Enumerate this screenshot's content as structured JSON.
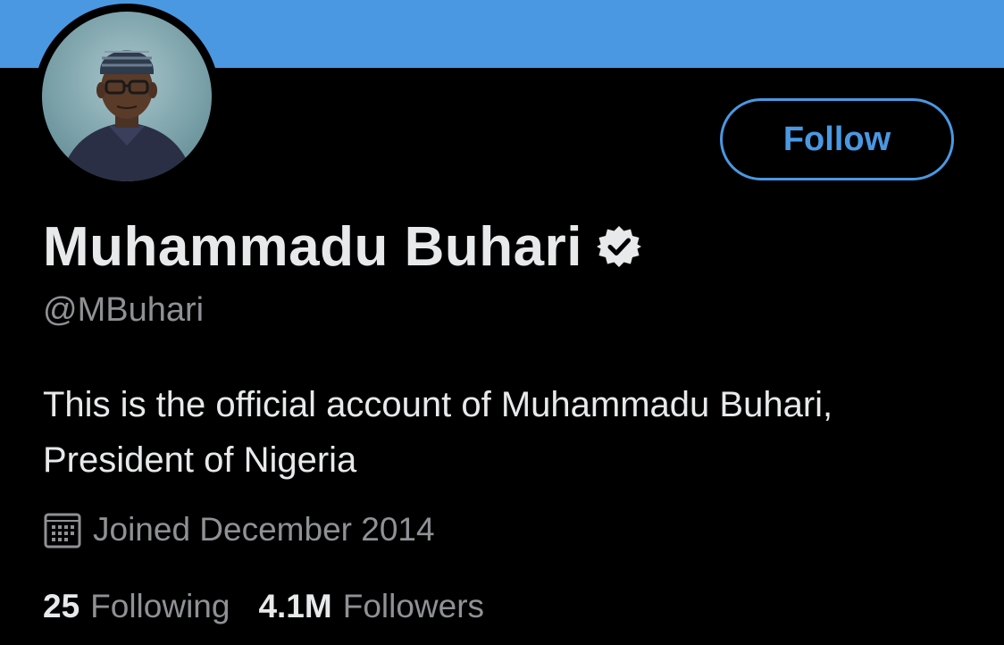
{
  "profile": {
    "banner_color": "#4a98e2",
    "avatar_icon": "profile-photo",
    "display_name": "Muhammadu Buhari",
    "verified_icon": "verified-badge-icon",
    "handle": "@MBuhari",
    "bio": "This is the official account of Muhammadu Buhari, President of Nigeria",
    "joined_icon": "calendar-icon",
    "joined": "Joined December 2014"
  },
  "actions": {
    "follow_label": "Follow"
  },
  "stats": {
    "following_count": "25",
    "following_label": "Following",
    "followers_count": "4.1M",
    "followers_label": "Followers"
  },
  "colors": {
    "accent": "#4a98e2",
    "background": "#000000",
    "primary_text": "#e7e9ea",
    "secondary_text": "#8f9194"
  }
}
